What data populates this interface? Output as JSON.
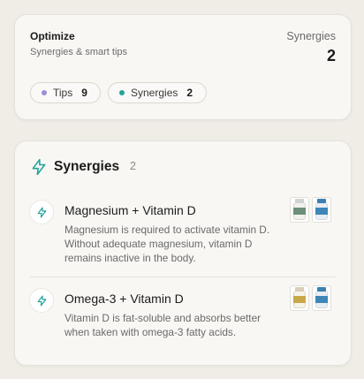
{
  "summary": {
    "title": "Optimize",
    "subtitle": "Synergies & smart tips",
    "stat_label": "Synergies",
    "stat_value": "2",
    "pills": [
      {
        "label": "Tips",
        "count": "9",
        "dot_color": "#9b8fd6"
      },
      {
        "label": "Synergies",
        "count": "2",
        "dot_color": "#23a39a"
      }
    ]
  },
  "synergies": {
    "title": "Synergies",
    "count": "2",
    "icon": "lightning-icon",
    "accent": "#23a39a",
    "items": [
      {
        "title": "Magnesium + Vitamin D",
        "description": "Magnesium is required to activate vitamin D. Without adequate magnesium, vitamin D remains inactive in the body.",
        "icon": "lightning-icon",
        "products": [
          "magnesium-bottle-image",
          "vitamin-d-bottle-image"
        ]
      },
      {
        "title": "Omega-3 + Vitamin D",
        "description": "Vitamin D is fat-soluble and absorbs better when taken with omega-3 fatty acids.",
        "icon": "lightning-icon",
        "products": [
          "omega-3-bottle-image",
          "vitamin-d-bottle-image"
        ]
      }
    ]
  }
}
